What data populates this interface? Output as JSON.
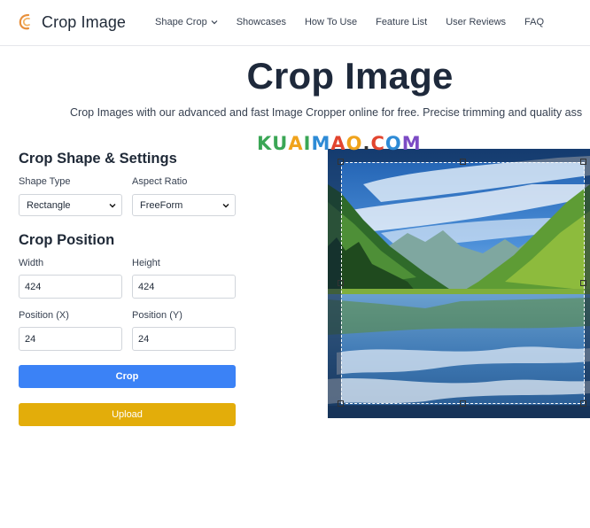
{
  "header": {
    "brand": "Crop Image",
    "nav": [
      {
        "label": "Shape Crop",
        "has_dropdown": true
      },
      {
        "label": "Showcases"
      },
      {
        "label": "How To Use"
      },
      {
        "label": "Feature List"
      },
      {
        "label": "User Reviews"
      },
      {
        "label": "FAQ"
      }
    ]
  },
  "hero": {
    "title": "Crop Image",
    "subtitle": "Crop Images with our advanced and fast Image Cropper online for free. Precise trimming and quality ass"
  },
  "shape_settings": {
    "title": "Crop Shape & Settings",
    "shape_type_label": "Shape Type",
    "shape_type_value": "Rectangle",
    "aspect_ratio_label": "Aspect Ratio",
    "aspect_ratio_value": "FreeForm"
  },
  "position": {
    "title": "Crop Position",
    "width_label": "Width",
    "width_value": "424",
    "height_label": "Height",
    "height_value": "424",
    "pos_x_label": "Position (X)",
    "pos_x_value": "24",
    "pos_y_label": "Position (Y)",
    "pos_y_value": "24"
  },
  "actions": {
    "crop_label": "Crop",
    "upload_label": "Upload"
  },
  "watermark": {
    "letters": [
      "K",
      "U",
      "A",
      "I",
      "M",
      "A",
      "O",
      ".",
      "C",
      "O",
      "M"
    ],
    "colors": [
      "#3aa655",
      "#3aa655",
      "#f0a31c",
      "#3aa655",
      "#2e8bd6",
      "#e2452f",
      "#f0a31c",
      "#333333",
      "#e2452f",
      "#2e8bd6",
      "#7c4bc4"
    ]
  },
  "colors": {
    "crop_button": "#3b82f6",
    "upload_button": "#e3ad0a",
    "title": "#1e293b"
  }
}
